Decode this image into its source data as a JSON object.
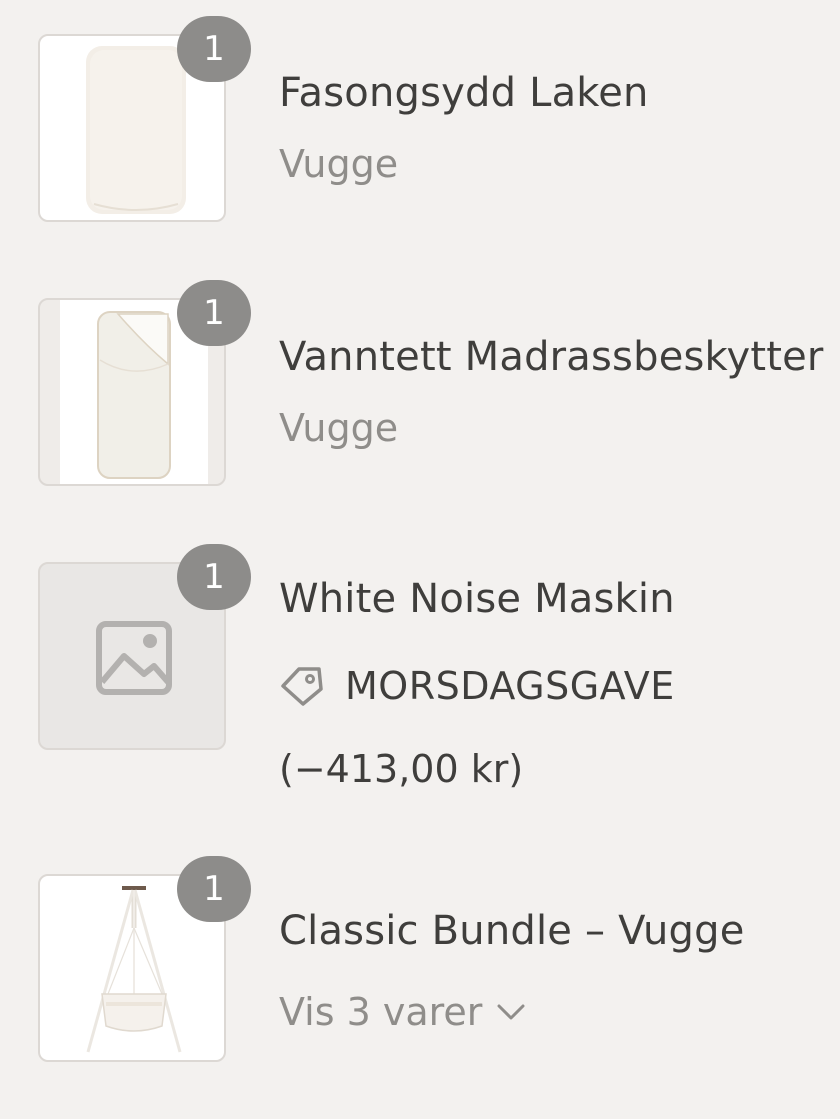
{
  "items": [
    {
      "quantity": "1",
      "title": "Fasongsydd Laken",
      "variant": "Vugge",
      "thumbnail": "fitted-sheet-image"
    },
    {
      "quantity": "1",
      "title": "Vanntett Madrassbeskytter",
      "variant": "Vugge",
      "thumbnail": "mattress-protector-image"
    },
    {
      "quantity": "1",
      "title": "White Noise Maskin",
      "thumbnail": "image-placeholder-icon",
      "discount": {
        "icon": "tag-icon",
        "code": "MORSDAGSGAVE",
        "amount": "(−413,00 kr)"
      }
    },
    {
      "quantity": "1",
      "title": "Classic Bundle – Vugge",
      "thumbnail": "cradle-stand-image",
      "toggle_label": "Vis 3 varer",
      "toggle_icon": "chevron-down-icon"
    }
  ],
  "colors": {
    "background": "#f3f1ef",
    "badge": "#8d8c8a",
    "text": "#3f3e3c",
    "muted": "#8f8d8a"
  }
}
